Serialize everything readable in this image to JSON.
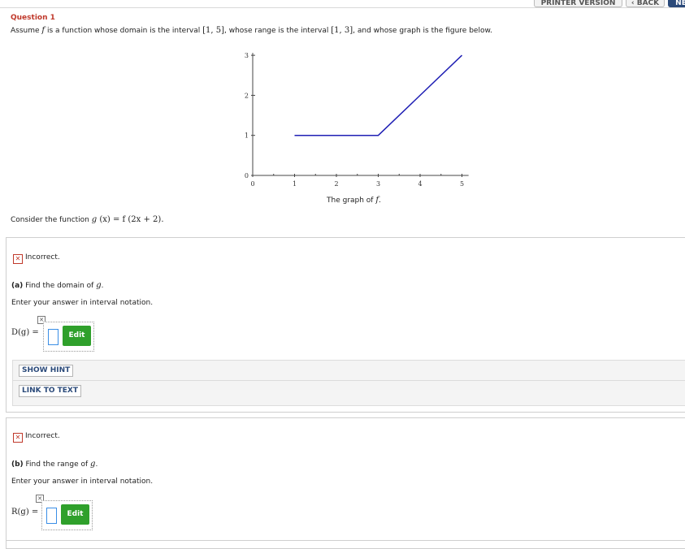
{
  "nav": {
    "printer_version": "PRINTER VERSION",
    "back": "BACK",
    "back_arrow": "‹",
    "next": "NE"
  },
  "question": {
    "title": "Question 1",
    "text_1": "Assume ",
    "f": "f",
    "text_2": " is a function whose domain is the interval ",
    "domain_interval": "[1, 5]",
    "text_3": ", whose range is the interval ",
    "range_interval": "[1, 3]",
    "text_4": ", and whose graph is the figure below."
  },
  "graph": {
    "caption_prefix": "The graph of ",
    "caption_var": "f",
    "caption_suffix": "."
  },
  "chart_data": {
    "type": "line",
    "title": "",
    "xlabel": "",
    "ylabel": "",
    "xlim": [
      0,
      5.1
    ],
    "ylim": [
      0,
      3
    ],
    "xticks": [
      0,
      1,
      2,
      3,
      4,
      5
    ],
    "yticks": [
      0,
      1,
      2,
      3
    ],
    "series": [
      {
        "x": [
          1,
          3,
          5
        ],
        "y": [
          1,
          1,
          3
        ]
      }
    ],
    "grid": false,
    "line_color": "#1f1fb4"
  },
  "consider": {
    "text": "Consider the function ",
    "g": "g",
    "expr": " (x) = f (2x + 2)."
  },
  "part_a": {
    "status_icon": "✕",
    "status": "Incorrect.",
    "label": "(a)",
    "text": " Find the domain of ",
    "var": "g",
    "period": ".",
    "instruction": "Enter your answer in interval notation.",
    "lhs": "D(g) =",
    "edit_label": "Edit",
    "mini_icon": "✕"
  },
  "hints": {
    "show_hint": "SHOW HINT",
    "link_to_text": "LINK TO TEXT"
  },
  "part_b": {
    "status_icon": "✕",
    "status": "Incorrect.",
    "label": "(b)",
    "text": " Find the range of ",
    "var": "g",
    "period": ".",
    "instruction": "Enter your answer in interval notation.",
    "lhs": "R(g) =",
    "edit_label": "Edit",
    "mini_icon": "✕"
  },
  "colors": {
    "accent_red": "#c0392b",
    "edit_green": "#2fa02b",
    "link_blue": "#2b4a7a"
  }
}
